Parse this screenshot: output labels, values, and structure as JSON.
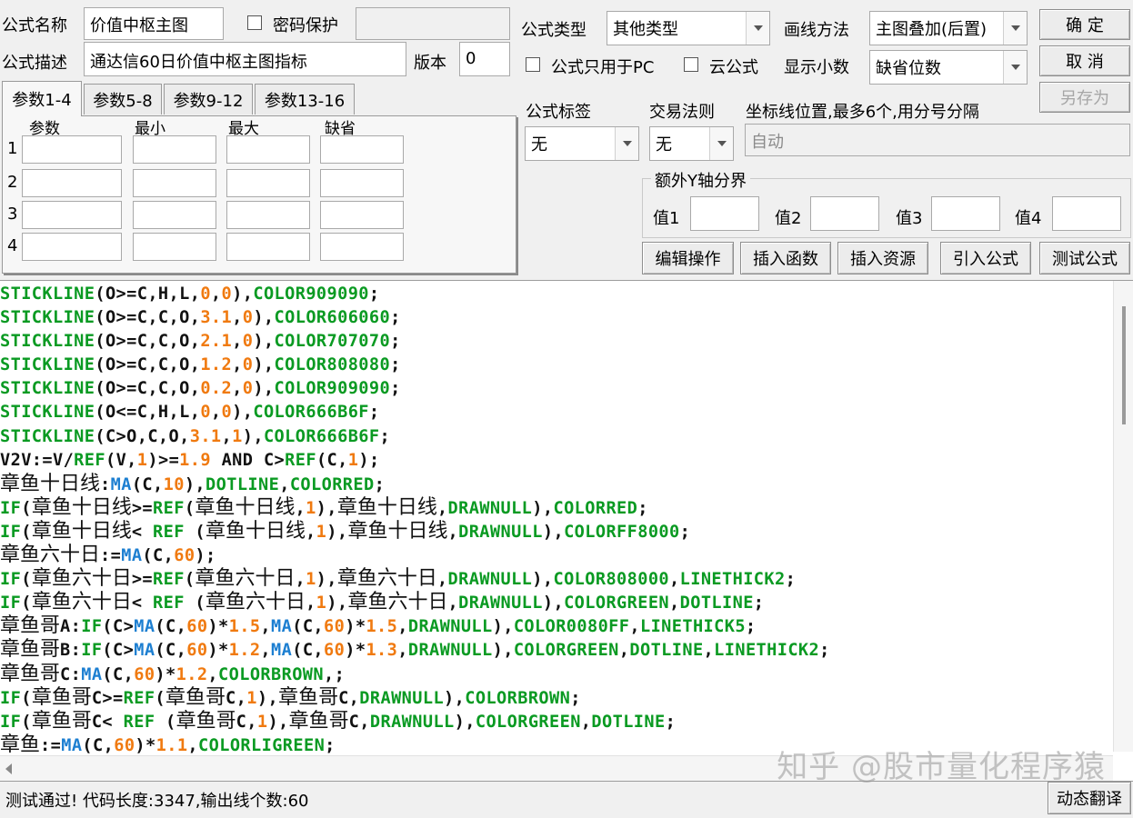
{
  "form": {
    "name_label": "公式名称",
    "name_value": "价值中枢主图",
    "password_label": "密码保护",
    "password_value": "",
    "desc_label": "公式描述",
    "desc_value": "通达信60日价值中枢主图指标",
    "version_label": "版本",
    "version_value": "0",
    "type_label": "公式类型",
    "type_value": "其他类型",
    "draw_label": "画线方法",
    "draw_value": "主图叠加(后置)",
    "pc_only_label": "公式只用于PC",
    "cloud_label": "云公式",
    "decimals_label": "显示小数",
    "decimals_value": "缺省位数",
    "tag_label": "公式标签",
    "tag_value": "无",
    "trade_rule_label": "交易法则",
    "trade_rule_value": "无",
    "axis_label": "坐标线位置,最多6个,用分号分隔",
    "axis_value": "自动",
    "extra_y_label": "额外Y轴分界",
    "extra_y": [
      {
        "label": "值1",
        "value": ""
      },
      {
        "label": "值2",
        "value": ""
      },
      {
        "label": "值3",
        "value": ""
      },
      {
        "label": "值4",
        "value": ""
      }
    ]
  },
  "buttons": {
    "ok": "确  定",
    "cancel": "取  消",
    "save_as": "另存为",
    "edit_ops": "编辑操作",
    "insert_func": "插入函数",
    "insert_res": "插入资源",
    "import_formula": "引入公式",
    "test_formula": "测试公式",
    "dynamic_translate": "动态翻译"
  },
  "tabs": [
    "参数1-4",
    "参数5-8",
    "参数9-12",
    "参数13-16"
  ],
  "params": {
    "headers": [
      "参数",
      "最小",
      "最大",
      "缺省"
    ],
    "rows": [
      "1",
      "2",
      "3",
      "4"
    ]
  },
  "code_lines": [
    [
      [
        "kw",
        "STICKLINE"
      ],
      [
        "op",
        "(O>=C,H,L,"
      ],
      [
        "num",
        "0"
      ],
      [
        "op",
        ","
      ],
      [
        "num",
        "0"
      ],
      [
        "op",
        "),"
      ],
      [
        "kw",
        "COLOR909090"
      ],
      [
        "op",
        ";"
      ]
    ],
    [
      [
        "kw",
        "STICKLINE"
      ],
      [
        "op",
        "(O>=C,C,O,"
      ],
      [
        "num",
        "3.1"
      ],
      [
        "op",
        ","
      ],
      [
        "num",
        "0"
      ],
      [
        "op",
        "),"
      ],
      [
        "kw",
        "COLOR606060"
      ],
      [
        "op",
        ";"
      ]
    ],
    [
      [
        "kw",
        "STICKLINE"
      ],
      [
        "op",
        "(O>=C,C,O,"
      ],
      [
        "num",
        "2.1"
      ],
      [
        "op",
        ","
      ],
      [
        "num",
        "0"
      ],
      [
        "op",
        "),"
      ],
      [
        "kw",
        "COLOR707070"
      ],
      [
        "op",
        ";"
      ]
    ],
    [
      [
        "kw",
        "STICKLINE"
      ],
      [
        "op",
        "(O>=C,C,O,"
      ],
      [
        "num",
        "1.2"
      ],
      [
        "op",
        ","
      ],
      [
        "num",
        "0"
      ],
      [
        "op",
        "),"
      ],
      [
        "kw",
        "COLOR808080"
      ],
      [
        "op",
        ";"
      ]
    ],
    [
      [
        "kw",
        "STICKLINE"
      ],
      [
        "op",
        "(O>=C,C,O,"
      ],
      [
        "num",
        "0.2"
      ],
      [
        "op",
        ","
      ],
      [
        "num",
        "0"
      ],
      [
        "op",
        "),"
      ],
      [
        "kw",
        "COLOR909090"
      ],
      [
        "op",
        ";"
      ]
    ],
    [
      [
        "kw",
        "STICKLINE"
      ],
      [
        "op",
        "(O<=C,H,L,"
      ],
      [
        "num",
        "0"
      ],
      [
        "op",
        ","
      ],
      [
        "num",
        "0"
      ],
      [
        "op",
        "),"
      ],
      [
        "kw",
        "COLOR666B6F"
      ],
      [
        "op",
        ";"
      ]
    ],
    [
      [
        "kw",
        "STICKLINE"
      ],
      [
        "op",
        "(C>O,C,O,"
      ],
      [
        "num",
        "3.1"
      ],
      [
        "op",
        ","
      ],
      [
        "num",
        "1"
      ],
      [
        "op",
        "),"
      ],
      [
        "kw",
        "COLOR666B6F"
      ],
      [
        "op",
        ";"
      ]
    ],
    [
      [
        "op",
        "V2V:=V/"
      ],
      [
        "kw",
        "REF"
      ],
      [
        "op",
        "(V,"
      ],
      [
        "num",
        "1"
      ],
      [
        "op",
        ")>="
      ],
      [
        "num",
        "1.9"
      ],
      [
        "op",
        " AND C>"
      ],
      [
        "kw",
        "REF"
      ],
      [
        "op",
        "(C,"
      ],
      [
        "num",
        "1"
      ],
      [
        "op",
        ");"
      ]
    ],
    [
      [
        "id",
        "章鱼十日线"
      ],
      [
        "op",
        ":"
      ],
      [
        "fn",
        "MA"
      ],
      [
        "op",
        "(C,"
      ],
      [
        "num",
        "10"
      ],
      [
        "op",
        "),"
      ],
      [
        "kw",
        "DOTLINE"
      ],
      [
        "op",
        ","
      ],
      [
        "kw",
        "COLORRED"
      ],
      [
        "op",
        ";"
      ]
    ],
    [
      [
        "kw",
        "IF"
      ],
      [
        "op",
        "("
      ],
      [
        "id",
        "章鱼十日线"
      ],
      [
        "op",
        ">="
      ],
      [
        "kw",
        "REF"
      ],
      [
        "op",
        "("
      ],
      [
        "id",
        "章鱼十日线"
      ],
      [
        "op",
        ","
      ],
      [
        "num",
        "1"
      ],
      [
        "op",
        "),"
      ],
      [
        "id",
        "章鱼十日线"
      ],
      [
        "op",
        ","
      ],
      [
        "kw",
        "DRAWNULL"
      ],
      [
        "op",
        "),"
      ],
      [
        "kw",
        "COLORRED"
      ],
      [
        "op",
        ";"
      ]
    ],
    [
      [
        "kw",
        "IF"
      ],
      [
        "op",
        "("
      ],
      [
        "id",
        "章鱼十日线"
      ],
      [
        "op",
        "< "
      ],
      [
        "kw",
        "REF"
      ],
      [
        "op",
        " ("
      ],
      [
        "id",
        "章鱼十日线"
      ],
      [
        "op",
        ","
      ],
      [
        "num",
        "1"
      ],
      [
        "op",
        "),"
      ],
      [
        "id",
        "章鱼十日线"
      ],
      [
        "op",
        ","
      ],
      [
        "kw",
        "DRAWNULL"
      ],
      [
        "op",
        "),"
      ],
      [
        "kw",
        "COLORFF8000"
      ],
      [
        "op",
        ";"
      ]
    ],
    [
      [
        "id",
        "章鱼六十日"
      ],
      [
        "op",
        ":="
      ],
      [
        "fn",
        "MA"
      ],
      [
        "op",
        "(C,"
      ],
      [
        "num",
        "60"
      ],
      [
        "op",
        ");"
      ]
    ],
    [
      [
        "kw",
        "IF"
      ],
      [
        "op",
        "("
      ],
      [
        "id",
        "章鱼六十日"
      ],
      [
        "op",
        ">="
      ],
      [
        "kw",
        "REF"
      ],
      [
        "op",
        "("
      ],
      [
        "id",
        "章鱼六十日"
      ],
      [
        "op",
        ","
      ],
      [
        "num",
        "1"
      ],
      [
        "op",
        "),"
      ],
      [
        "id",
        "章鱼六十日"
      ],
      [
        "op",
        ","
      ],
      [
        "kw",
        "DRAWNULL"
      ],
      [
        "op",
        "),"
      ],
      [
        "kw",
        "COLOR808000"
      ],
      [
        "op",
        ","
      ],
      [
        "kw",
        "LINETHICK2"
      ],
      [
        "op",
        ";"
      ]
    ],
    [
      [
        "kw",
        "IF"
      ],
      [
        "op",
        "("
      ],
      [
        "id",
        "章鱼六十日"
      ],
      [
        "op",
        "< "
      ],
      [
        "kw",
        "REF"
      ],
      [
        "op",
        " ("
      ],
      [
        "id",
        "章鱼六十日"
      ],
      [
        "op",
        ","
      ],
      [
        "num",
        "1"
      ],
      [
        "op",
        "),"
      ],
      [
        "id",
        "章鱼六十日"
      ],
      [
        "op",
        ","
      ],
      [
        "kw",
        "DRAWNULL"
      ],
      [
        "op",
        "),"
      ],
      [
        "kw",
        "COLORGREEN"
      ],
      [
        "op",
        ","
      ],
      [
        "kw",
        "DOTLINE"
      ],
      [
        "op",
        ";"
      ]
    ],
    [
      [
        "id",
        "章鱼哥"
      ],
      [
        "op",
        "A:"
      ],
      [
        "kw",
        "IF"
      ],
      [
        "op",
        "(C>"
      ],
      [
        "fn",
        "MA"
      ],
      [
        "op",
        "(C,"
      ],
      [
        "num",
        "60"
      ],
      [
        "op",
        ")*"
      ],
      [
        "num",
        "1.5"
      ],
      [
        "op",
        ","
      ],
      [
        "fn",
        "MA"
      ],
      [
        "op",
        "(C,"
      ],
      [
        "num",
        "60"
      ],
      [
        "op",
        ")*"
      ],
      [
        "num",
        "1.5"
      ],
      [
        "op",
        ","
      ],
      [
        "kw",
        "DRAWNULL"
      ],
      [
        "op",
        "),"
      ],
      [
        "kw",
        "COLOR0080FF"
      ],
      [
        "op",
        ","
      ],
      [
        "kw",
        "LINETHICK5"
      ],
      [
        "op",
        ";"
      ]
    ],
    [
      [
        "id",
        "章鱼哥"
      ],
      [
        "op",
        "B:"
      ],
      [
        "kw",
        "IF"
      ],
      [
        "op",
        "(C>"
      ],
      [
        "fn",
        "MA"
      ],
      [
        "op",
        "(C,"
      ],
      [
        "num",
        "60"
      ],
      [
        "op",
        ")*"
      ],
      [
        "num",
        "1.2"
      ],
      [
        "op",
        ","
      ],
      [
        "fn",
        "MA"
      ],
      [
        "op",
        "(C,"
      ],
      [
        "num",
        "60"
      ],
      [
        "op",
        ")*"
      ],
      [
        "num",
        "1.3"
      ],
      [
        "op",
        ","
      ],
      [
        "kw",
        "DRAWNULL"
      ],
      [
        "op",
        "),"
      ],
      [
        "kw",
        "COLORGREEN"
      ],
      [
        "op",
        ","
      ],
      [
        "kw",
        "DOTLINE"
      ],
      [
        "op",
        ","
      ],
      [
        "kw",
        "LINETHICK2"
      ],
      [
        "op",
        ";"
      ]
    ],
    [
      [
        "id",
        "章鱼哥"
      ],
      [
        "op",
        "C:"
      ],
      [
        "fn",
        "MA"
      ],
      [
        "op",
        "(C,"
      ],
      [
        "num",
        "60"
      ],
      [
        "op",
        ")*"
      ],
      [
        "num",
        "1.2"
      ],
      [
        "op",
        ","
      ],
      [
        "kw",
        "COLORBROWN"
      ],
      [
        "op",
        ",;"
      ]
    ],
    [
      [
        "kw",
        "IF"
      ],
      [
        "op",
        "("
      ],
      [
        "id",
        "章鱼哥"
      ],
      [
        "op",
        "C>="
      ],
      [
        "kw",
        "REF"
      ],
      [
        "op",
        "("
      ],
      [
        "id",
        "章鱼哥"
      ],
      [
        "op",
        "C,"
      ],
      [
        "num",
        "1"
      ],
      [
        "op",
        "),"
      ],
      [
        "id",
        "章鱼哥"
      ],
      [
        "op",
        "C,"
      ],
      [
        "kw",
        "DRAWNULL"
      ],
      [
        "op",
        "),"
      ],
      [
        "kw",
        "COLORBROWN"
      ],
      [
        "op",
        ";"
      ]
    ],
    [
      [
        "kw",
        "IF"
      ],
      [
        "op",
        "("
      ],
      [
        "id",
        "章鱼哥"
      ],
      [
        "op",
        "C< "
      ],
      [
        "kw",
        "REF"
      ],
      [
        "op",
        " ("
      ],
      [
        "id",
        "章鱼哥"
      ],
      [
        "op",
        "C,"
      ],
      [
        "num",
        "1"
      ],
      [
        "op",
        "),"
      ],
      [
        "id",
        "章鱼哥"
      ],
      [
        "op",
        "C,"
      ],
      [
        "kw",
        "DRAWNULL"
      ],
      [
        "op",
        "),"
      ],
      [
        "kw",
        "COLORGREEN"
      ],
      [
        "op",
        ","
      ],
      [
        "kw",
        "DOTLINE"
      ],
      [
        "op",
        ";"
      ]
    ],
    [
      [
        "id",
        "章鱼"
      ],
      [
        "op",
        ":="
      ],
      [
        "fn",
        "MA"
      ],
      [
        "op",
        "(C,"
      ],
      [
        "num",
        "60"
      ],
      [
        "op",
        ")*"
      ],
      [
        "num",
        "1.1"
      ],
      [
        "op",
        ","
      ],
      [
        "kw",
        "COLORLIGREEN"
      ],
      [
        "op",
        ";"
      ]
    ]
  ],
  "status_text": "测试通过! 代码长度:3347,输出线个数:60",
  "watermark": "知乎 @股市量化程序猿",
  "colors": {
    "keyword": "#0a9a22",
    "function": "#1d7fd1",
    "number": "#f07a10",
    "plain": "#111111"
  }
}
